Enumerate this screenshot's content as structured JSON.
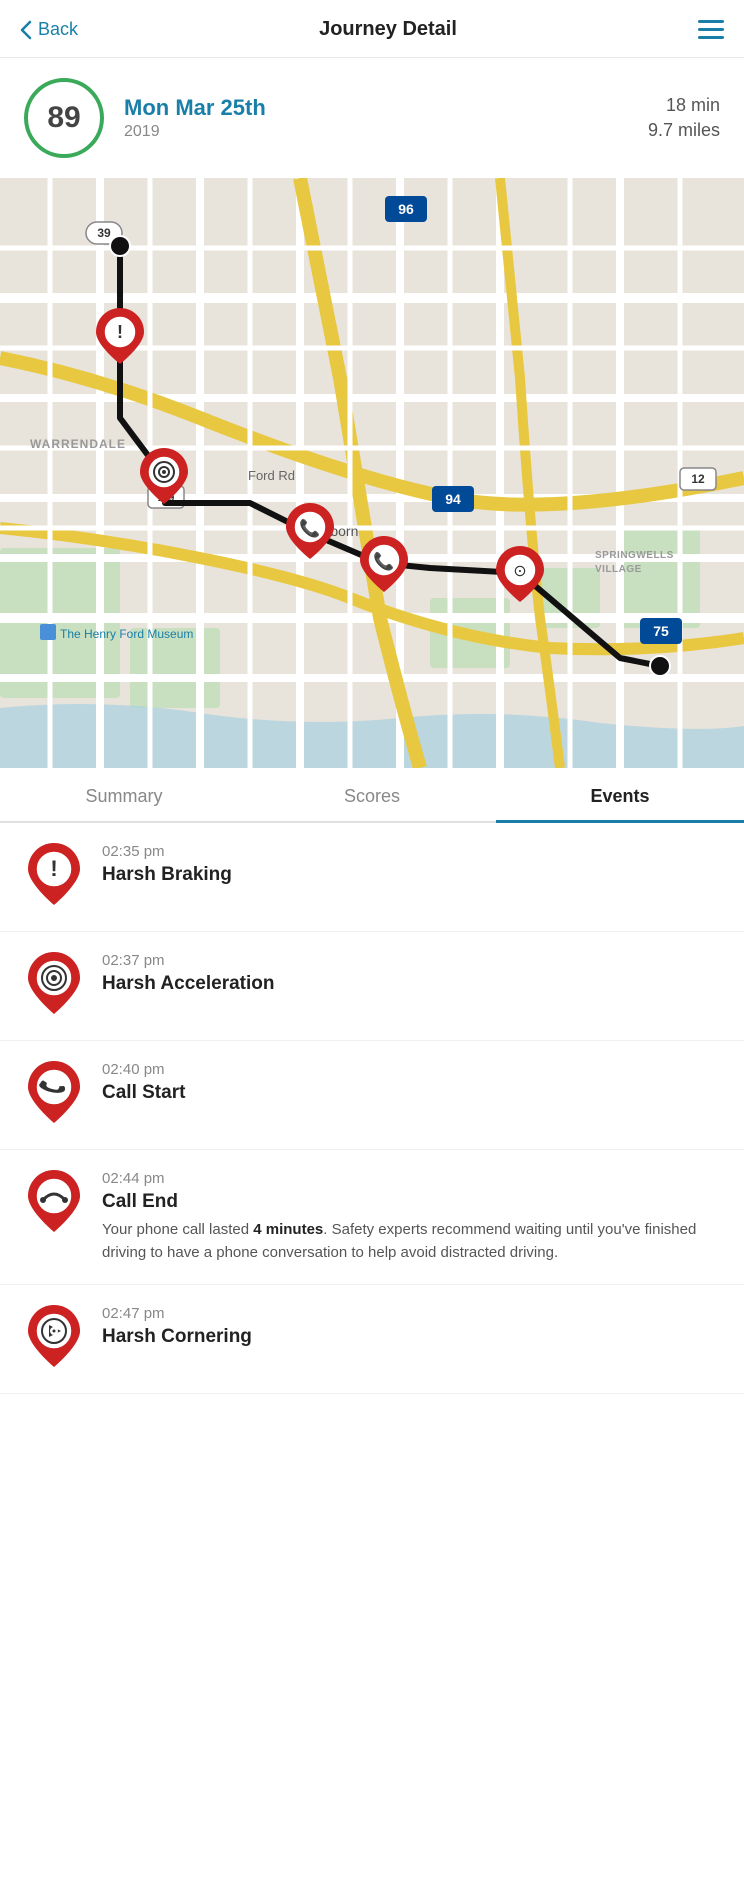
{
  "header": {
    "back_label": "Back",
    "title": "Journey Detail",
    "hamburger_aria": "Menu"
  },
  "journey": {
    "score": "89",
    "date": "Mon Mar 25th",
    "year": "2019",
    "duration": "18 min",
    "miles": "9.7 miles"
  },
  "tabs": [
    {
      "id": "summary",
      "label": "Summary",
      "active": false
    },
    {
      "id": "scores",
      "label": "Scores",
      "active": false
    },
    {
      "id": "events",
      "label": "Events",
      "active": true
    }
  ],
  "events": [
    {
      "icon_type": "braking",
      "time": "02:35 pm",
      "name": "Harsh Braking",
      "description": null
    },
    {
      "icon_type": "acceleration",
      "time": "02:37 pm",
      "name": "Harsh Acceleration",
      "description": null
    },
    {
      "icon_type": "call",
      "time": "02:40 pm",
      "name": "Call Start",
      "description": null
    },
    {
      "icon_type": "callend",
      "time": "02:44 pm",
      "name": "Call End",
      "description": "Your phone call lasted <strong>4 minutes</strong>. Safety experts recommend waiting until you've finished driving to have a phone conversation to help avoid distracted driving.",
      "description_text": "Your phone call lasted 4 minutes. Safety experts recommend waiting until you've finished driving to have a phone conversation to help avoid distracted driving.",
      "bold_part": "4 minutes"
    },
    {
      "icon_type": "cornering",
      "time": "02:47 pm",
      "name": "Harsh Cornering",
      "description": null
    }
  ],
  "colors": {
    "accent": "#1a7fa8",
    "score_ring": "#3aaa5a",
    "pin_red": "#cc2222",
    "tab_active_underline": "#1a7fa8"
  }
}
